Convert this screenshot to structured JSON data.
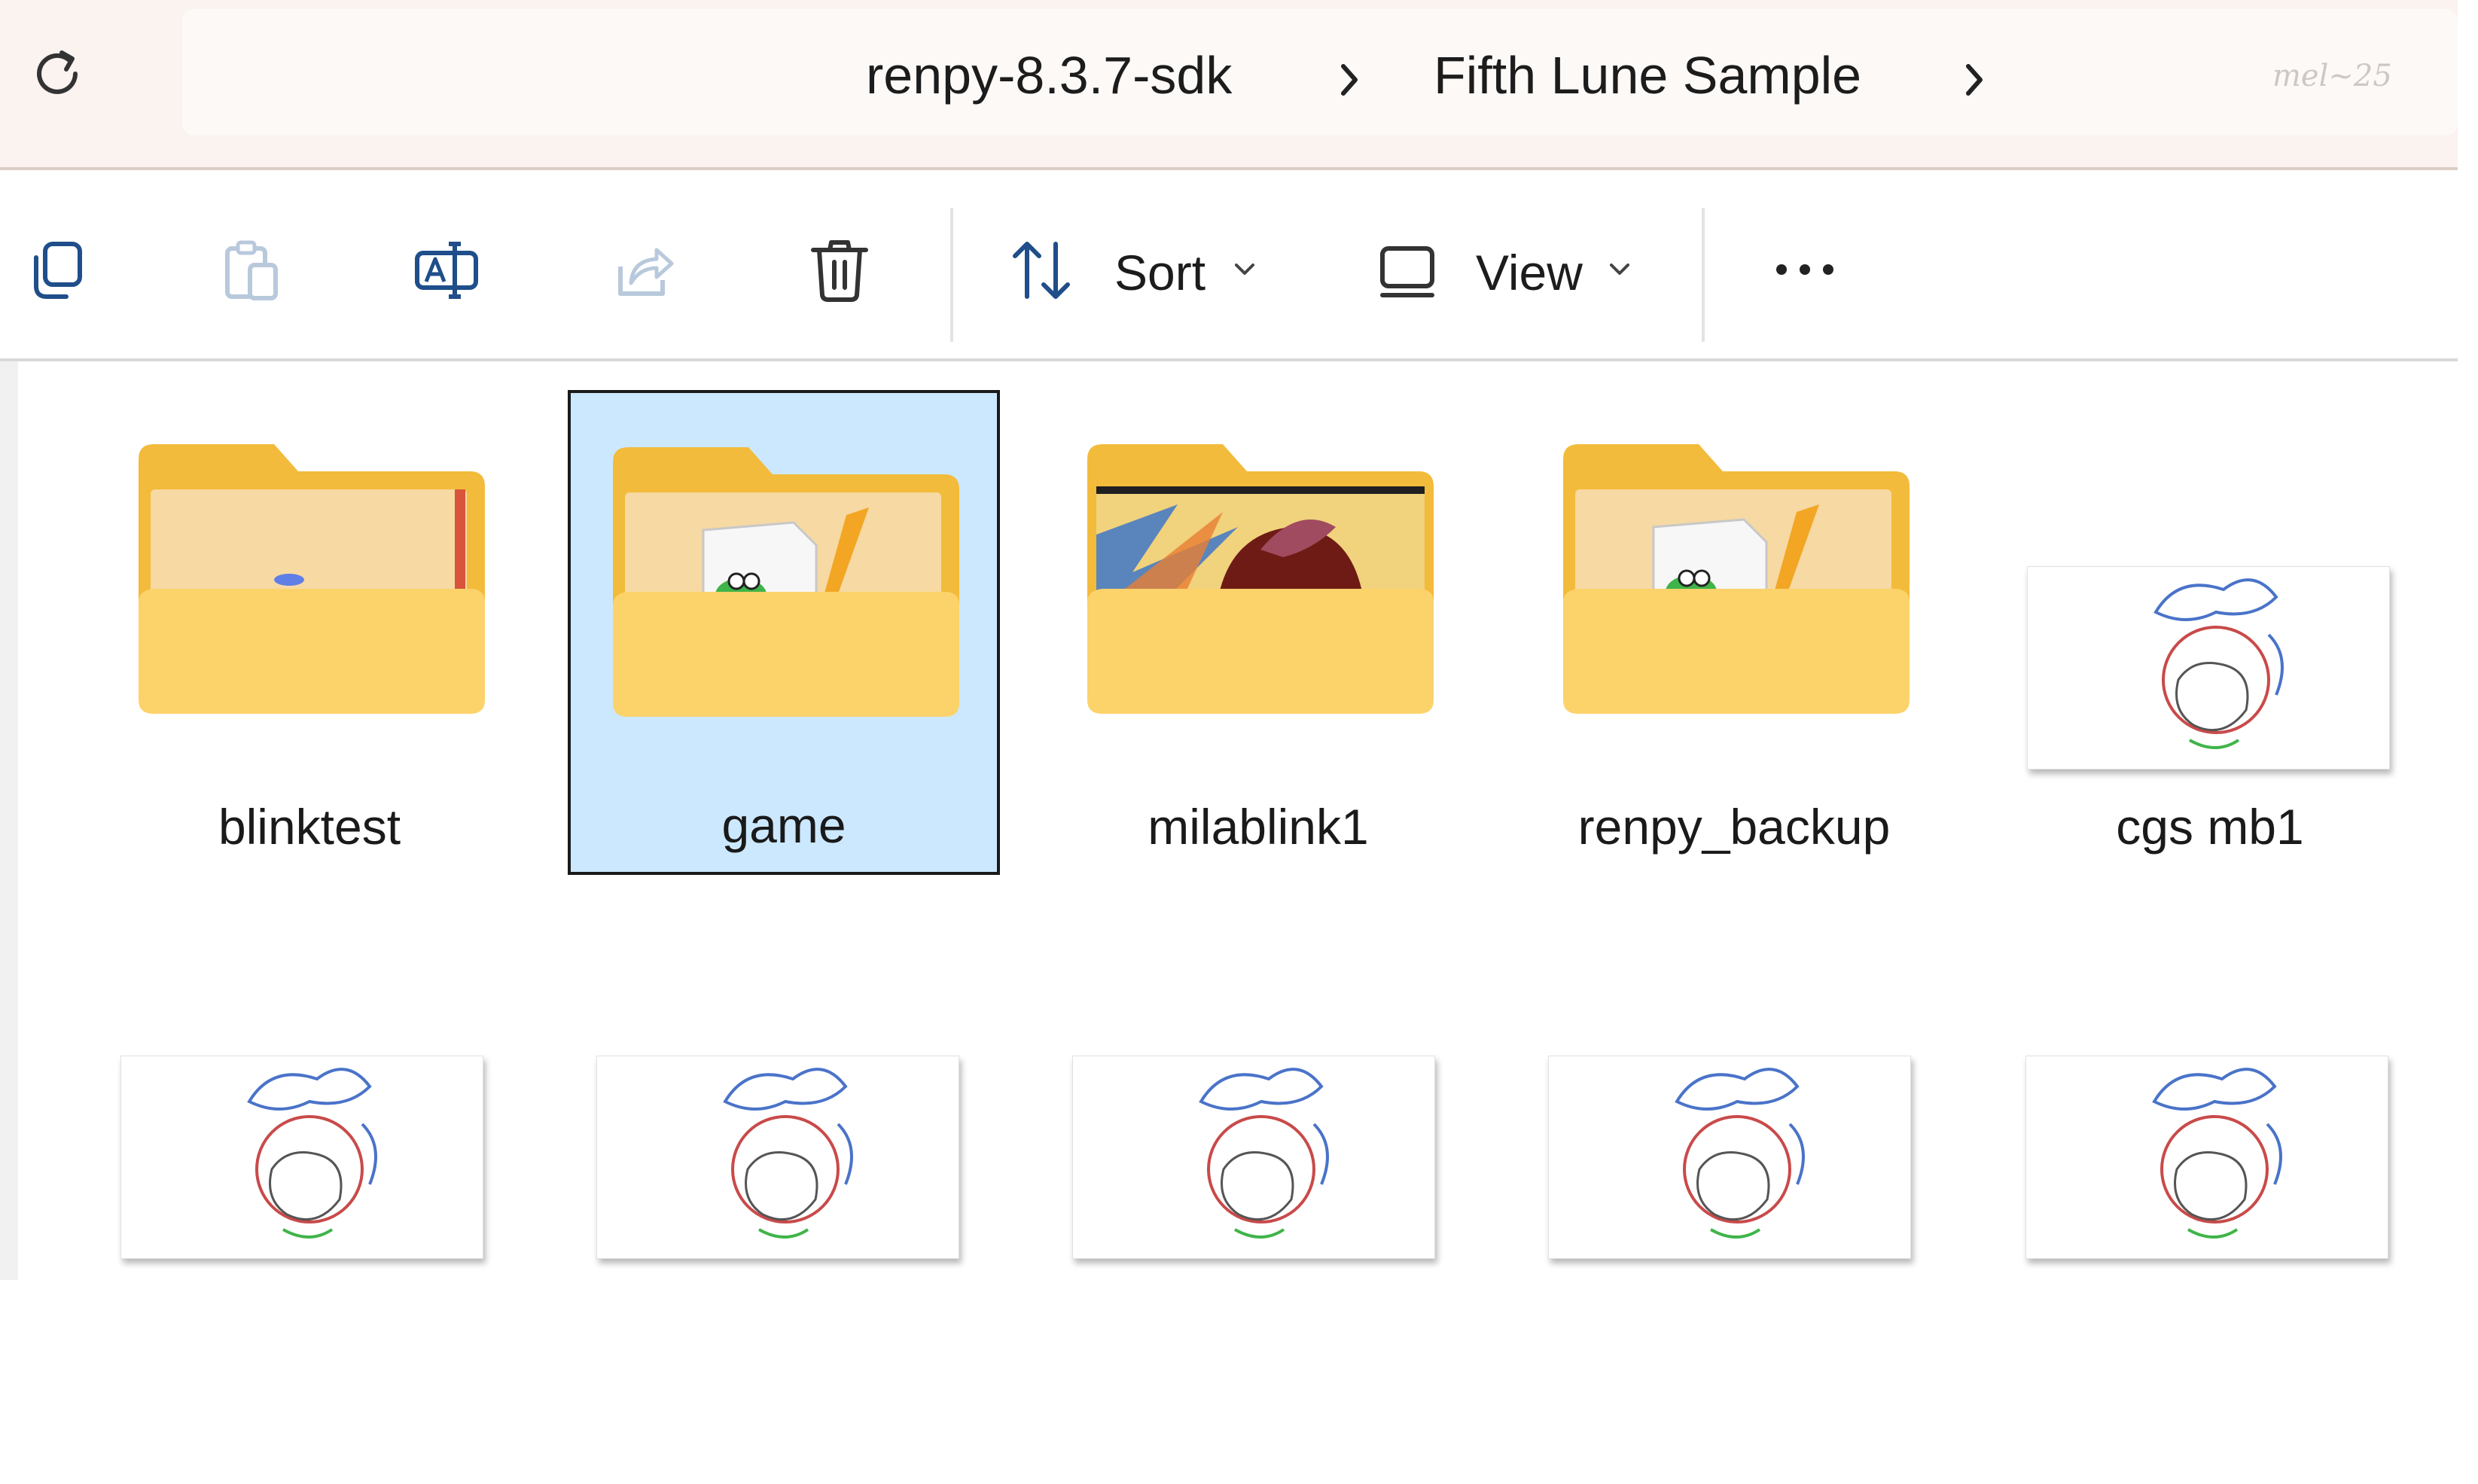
{
  "address_bar": {
    "crumbs": [
      "renpy-8.3.7-sdk",
      "Fifth Lune Sample"
    ],
    "watermark": "mel~25"
  },
  "toolbar": {
    "sort_label": "Sort",
    "view_label": "View"
  },
  "items": [
    {
      "name": "blinktest",
      "type": "folder",
      "selected": false
    },
    {
      "name": "game",
      "type": "folder",
      "selected": true
    },
    {
      "name": "milablink1",
      "type": "folder",
      "selected": false
    },
    {
      "name": "renpy_backup",
      "type": "folder",
      "selected": false
    },
    {
      "name": "cgs mb1",
      "type": "image",
      "selected": false
    },
    {
      "name": "",
      "type": "image",
      "selected": false
    },
    {
      "name": "",
      "type": "image",
      "selected": false
    },
    {
      "name": "",
      "type": "image",
      "selected": false
    },
    {
      "name": "",
      "type": "image",
      "selected": false
    },
    {
      "name": "",
      "type": "image",
      "selected": false
    }
  ],
  "colors": {
    "selection_fill": "#cce8ff",
    "folder_back": "#f3bb3b",
    "folder_front": "#fcd26a",
    "address_bg": "#faf3ef"
  }
}
